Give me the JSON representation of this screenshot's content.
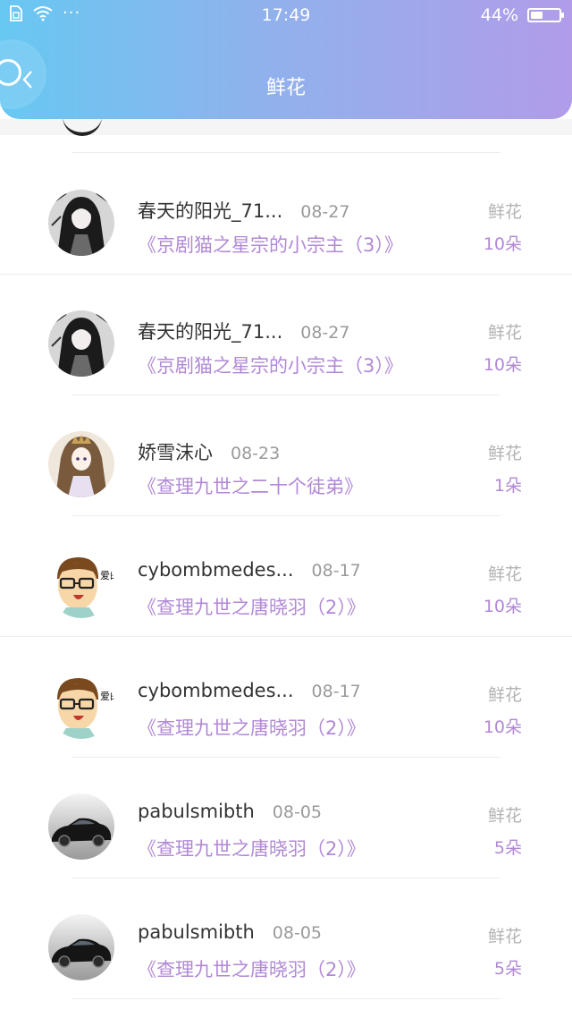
{
  "status_bar": {
    "time": "17:49",
    "battery": "44%",
    "battery_level": 0.44,
    "dots": "···",
    "icons": [
      "sim-icon",
      "wifi-icon",
      "battery-icon"
    ]
  },
  "header": {
    "title": "鲜花",
    "gradient": [
      "#67c8f2",
      "#b19cea"
    ]
  },
  "colors": {
    "accent": "#b188d6",
    "muted": "#9a9a9a"
  },
  "items": [
    {
      "name": "春天的阳光_71...",
      "date": "08-27",
      "book": "《京剧猫之星宗的小宗主（3）》",
      "label": "鲜花",
      "count": "10朵",
      "avatar": "anime-girl-dark-avatar"
    },
    {
      "name": "春天的阳光_71...",
      "date": "08-27",
      "book": "《京剧猫之星宗的小宗主（3）》",
      "label": "鲜花",
      "count": "10朵",
      "avatar": "anime-girl-dark-avatar"
    },
    {
      "name": "娇雪沫心",
      "date": "08-23",
      "book": "《查理九世之二十个徒弟》",
      "label": "鲜花",
      "count": "1朵",
      "avatar": "anime-girl-light-avatar"
    },
    {
      "name": "cybombmedes...",
      "date": "08-17",
      "book": "《查理九世之唐晓羽（2）》",
      "label": "鲜花",
      "count": "10朵",
      "avatar": "cartoon-man-glasses-avatar",
      "avatar_text": "爱的全对"
    },
    {
      "name": "cybombmedes...",
      "date": "08-17",
      "book": "《查理九世之唐晓羽（2）》",
      "label": "鲜花",
      "count": "10朵",
      "avatar": "cartoon-man-glasses-avatar",
      "avatar_text": "爱的全对"
    },
    {
      "name": "pabulsmibth",
      "date": "08-05",
      "book": "《查理九世之唐晓羽（2）》",
      "label": "鲜花",
      "count": "5朵",
      "avatar": "black-car-avatar"
    },
    {
      "name": "pabulsmibth",
      "date": "08-05",
      "book": "《查理九世之唐晓羽（2）》",
      "label": "鲜花",
      "count": "5朵",
      "avatar": "black-car-avatar"
    }
  ]
}
